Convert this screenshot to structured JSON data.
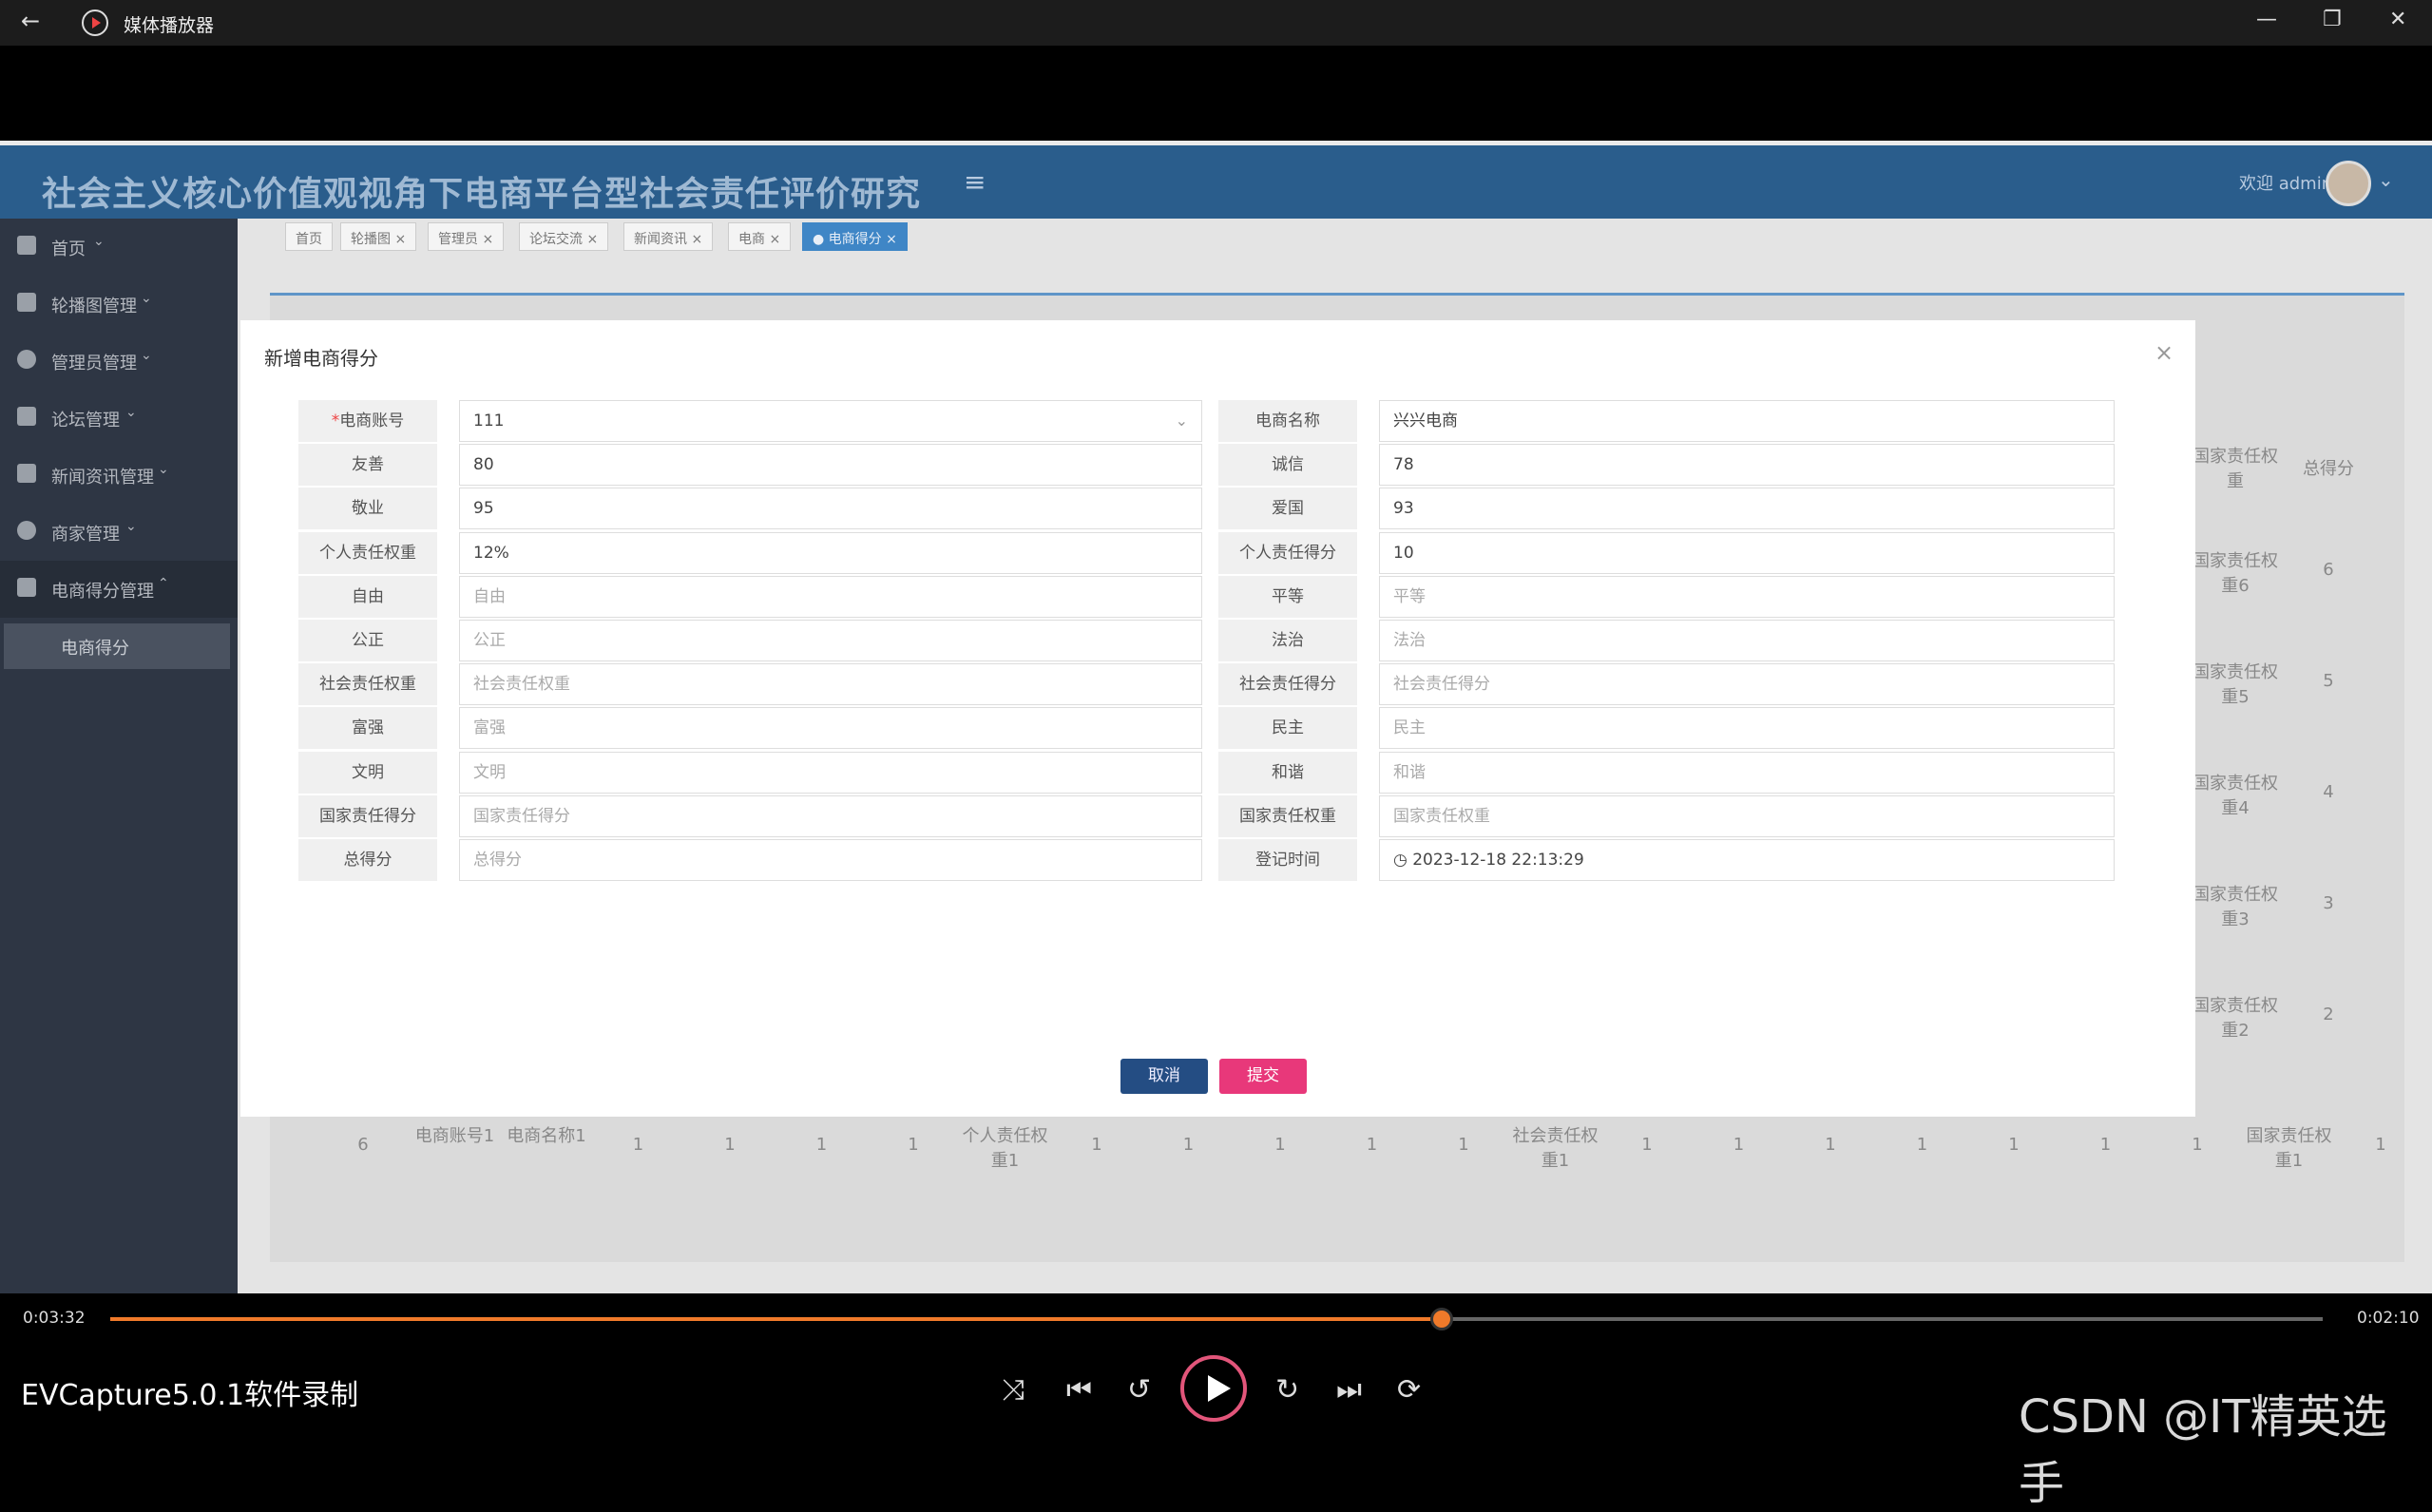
{
  "player": {
    "title": "媒体播放器",
    "back_icon": "←",
    "min_icon": "—",
    "max_icon": "❐",
    "close_icon": "✕",
    "time_current": "0:03:32",
    "time_total": "0:02:10",
    "progress_fraction": 0.602,
    "caption": "EVCapture5.0.1软件录制",
    "watermark": "CSDN @IT精英选手",
    "controls": {
      "shuffle": "⤨",
      "prev": "⏮",
      "rewind": "↺",
      "forward": "↻",
      "next": "⏭",
      "repeat": "⟳"
    }
  },
  "app": {
    "title": "社会主义核心价值观视角下电商平台型社会责任评价研究",
    "menu_icon": "≡",
    "welcome": "欢迎 admin",
    "chevron": "⌄"
  },
  "sidebar": {
    "items": [
      {
        "label": "首页",
        "caret": "⌄"
      },
      {
        "label": "轮播图管理",
        "caret": "⌄"
      },
      {
        "label": "管理员管理",
        "caret": "⌄"
      },
      {
        "label": "论坛管理",
        "caret": "⌄"
      },
      {
        "label": "新闻资讯管理",
        "caret": "⌄"
      },
      {
        "label": "商家管理",
        "caret": "⌄"
      },
      {
        "label": "电商得分管理",
        "caret": "⌃"
      }
    ],
    "sub_item": "电商得分"
  },
  "tabs": [
    {
      "label": "首页"
    },
    {
      "label": "轮播图 ×"
    },
    {
      "label": "管理员 ×"
    },
    {
      "label": "论坛交流 ×"
    },
    {
      "label": "新闻资讯 ×"
    },
    {
      "label": "电商 ×"
    },
    {
      "label": "● 电商得分 ×"
    }
  ],
  "background_table": {
    "header_right": [
      "国家责任权重",
      "总得分"
    ],
    "right_rows": [
      {
        "weight": "国家责任权重6",
        "score": "6"
      },
      {
        "weight": "国家责任权重5",
        "score": "5"
      },
      {
        "weight": "国家责任权重4",
        "score": "4"
      },
      {
        "weight": "国家责任权重3",
        "score": "3"
      },
      {
        "weight": "国家责任权重2",
        "score": "2"
      }
    ],
    "last_row": [
      "6",
      "电商账号1",
      "电商名称1",
      "1",
      "1",
      "1",
      "1",
      "个人责任权重1",
      "1",
      "1",
      "1",
      "1",
      "1",
      "社会责任权重1",
      "1",
      "1",
      "1",
      "1",
      "1",
      "1",
      "1",
      "国家责任权重1",
      "1"
    ]
  },
  "modal": {
    "title": "新增电商得分",
    "close": "×",
    "required_mark": "*",
    "left": [
      {
        "label": "电商账号",
        "value": "111",
        "placeholder": "",
        "select": true
      },
      {
        "label": "友善",
        "value": "80",
        "placeholder": ""
      },
      {
        "label": "敬业",
        "value": "95",
        "placeholder": ""
      },
      {
        "label": "个人责任权重",
        "value": "12%",
        "placeholder": ""
      },
      {
        "label": "自由",
        "value": "",
        "placeholder": "自由"
      },
      {
        "label": "公正",
        "value": "",
        "placeholder": "公正"
      },
      {
        "label": "社会责任权重",
        "value": "",
        "placeholder": "社会责任权重"
      },
      {
        "label": "富强",
        "value": "",
        "placeholder": "富强"
      },
      {
        "label": "文明",
        "value": "",
        "placeholder": "文明"
      },
      {
        "label": "国家责任得分",
        "value": "",
        "placeholder": "国家责任得分"
      },
      {
        "label": "总得分",
        "value": "",
        "placeholder": "总得分"
      }
    ],
    "right": [
      {
        "label": "电商名称",
        "value": "兴兴电商",
        "placeholder": ""
      },
      {
        "label": "诚信",
        "value": "78",
        "placeholder": ""
      },
      {
        "label": "爱国",
        "value": "93",
        "placeholder": ""
      },
      {
        "label": "个人责任得分",
        "value": "10",
        "placeholder": ""
      },
      {
        "label": "平等",
        "value": "",
        "placeholder": "平等"
      },
      {
        "label": "法治",
        "value": "",
        "placeholder": "法治"
      },
      {
        "label": "社会责任得分",
        "value": "",
        "placeholder": "社会责任得分"
      },
      {
        "label": "民主",
        "value": "",
        "placeholder": "民主"
      },
      {
        "label": "和谐",
        "value": "",
        "placeholder": "和谐"
      },
      {
        "label": "国家责任权重",
        "value": "",
        "placeholder": "国家责任权重"
      },
      {
        "label": "登记时间",
        "value": "◷  2023-12-18 22:13:29",
        "placeholder": ""
      }
    ],
    "cancel": "取消",
    "submit": "提交"
  }
}
